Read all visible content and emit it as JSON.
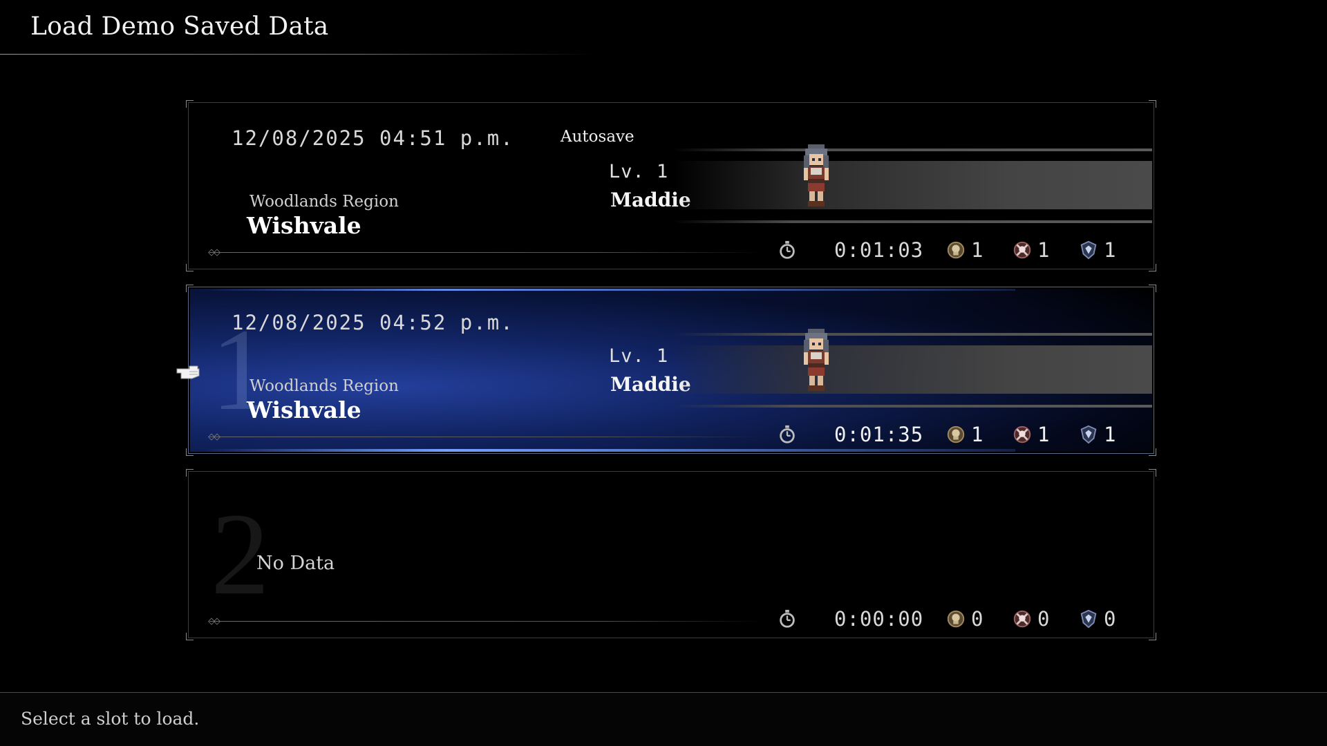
{
  "header": {
    "title": "Load Demo Saved Data"
  },
  "slots": [
    {
      "number": "",
      "datetime": "12/08/2025  04:51 p.m.",
      "tag": "Autosave",
      "region": "Woodlands Region",
      "place": "Wishvale",
      "level": "Lv. 1",
      "character": "Maddie",
      "playtime": "0:01:03",
      "stat_a": "1",
      "stat_b": "1",
      "stat_c": "1"
    },
    {
      "number": "1",
      "datetime": "12/08/2025  04:52 p.m.",
      "region": "Woodlands Region",
      "place": "Wishvale",
      "level": "Lv. 1",
      "character": "Maddie",
      "playtime": "0:01:35",
      "stat_a": "1",
      "stat_b": "1",
      "stat_c": "1",
      "selected": true
    },
    {
      "number": "2",
      "status": "No Data",
      "playtime": "0:00:00",
      "stat_a": "0",
      "stat_b": "0",
      "stat_c": "0"
    }
  ],
  "icons": [
    "stopwatch-icon",
    "skull-badge-icon",
    "crossed-skull-icon",
    "crystal-shield-icon",
    "pointing-hand-cursor-icon"
  ],
  "colors": {
    "accent": "#2a4aa8",
    "background": "#000000",
    "text": "#e6e6e6"
  },
  "footer": {
    "help": "Select a slot to load."
  }
}
